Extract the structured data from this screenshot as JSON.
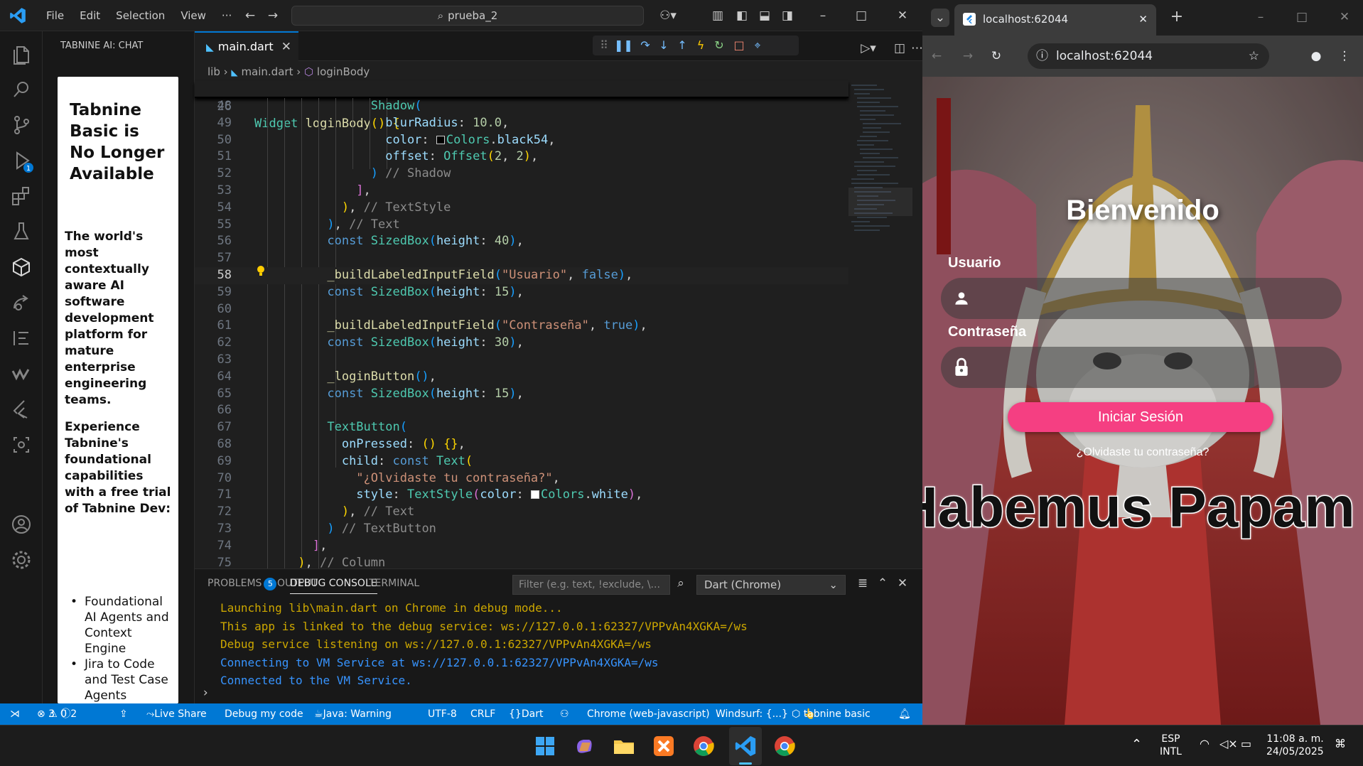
{
  "vscode": {
    "menu": [
      "File",
      "Edit",
      "Selection",
      "View",
      "···"
    ],
    "search": "prueba_2",
    "sidebar_title": "TABNINE AI: CHAT",
    "tabnine": {
      "heading": "Tabnine Basic is No Longer Available",
      "p1": "The world's most contextually aware AI software development platform for mature enterprise engineering teams.",
      "p2": "Experience Tabnine's foundational capabilities with a free trial of Tabnine Dev:",
      "list": [
        "Foundational AI Agents and Context Engine",
        "Jira to Code and Test Case Agents"
      ]
    },
    "tab": "main.dart",
    "breadcrumb": [
      "lib",
      "main.dart",
      "loginBody"
    ],
    "sticky": {
      "line": "26",
      "text": "Widget loginBody() {"
    },
    "current_line": "58",
    "code_lines": [
      {
        "n": "48",
        "html": "<span class='ty'>Shadow</span><span class='br3'>(</span>"
      },
      {
        "n": "49",
        "html": "  <span class='pr'>blurRadius</span>: <span class='nm'>10.0</span>,"
      },
      {
        "n": "50",
        "html": "  <span class='pr'>color</span>: <span class='swatch' style='background:#000'></span><span class='ty'>Colors</span>.<span class='pr'>black54</span>,"
      },
      {
        "n": "51",
        "html": "  <span class='pr'>offset</span>: <span class='ty'>Offset</span><span class='br1'>(</span><span class='nm'>2</span>, <span class='nm'>2</span><span class='br1'>)</span>,"
      },
      {
        "n": "52",
        "html": "<span class='br3'>)</span> <span class='gr'>// Shadow</span>"
      },
      {
        "n": "53",
        "html": "<span class='br2'>]</span>,"
      },
      {
        "n": "54",
        "html": "<span class='br1'>)</span>, <span class='gr'>// TextStyle</span>"
      },
      {
        "n": "55",
        "html": "<span class='br3'>)</span>, <span class='gr'>// Text</span>"
      },
      {
        "n": "56",
        "html": "<span class='kw'>const</span> <span class='ty'>SizedBox</span><span class='br3'>(</span><span class='pr'>height</span>: <span class='nm'>40</span><span class='br3'>)</span>,"
      },
      {
        "n": "57",
        "html": ""
      },
      {
        "n": "58",
        "html": "<span class='fn'>_buildLabeledInputField</span><span class='br3'>(</span><span class='st'>\"Usuario\"</span>, <span class='kw'>false</span><span class='br3'>)</span>,"
      },
      {
        "n": "59",
        "html": "<span class='kw'>const</span> <span class='ty'>SizedBox</span><span class='br3'>(</span><span class='pr'>height</span>: <span class='nm'>15</span><span class='br3'>)</span>,"
      },
      {
        "n": "60",
        "html": ""
      },
      {
        "n": "61",
        "html": "<span class='fn'>_buildLabeledInputField</span><span class='br3'>(</span><span class='st'>\"Contraseña\"</span>, <span class='kw'>true</span><span class='br3'>)</span>,"
      },
      {
        "n": "62",
        "html": "<span class='kw'>const</span> <span class='ty'>SizedBox</span><span class='br3'>(</span><span class='pr'>height</span>: <span class='nm'>30</span><span class='br3'>)</span>,"
      },
      {
        "n": "63",
        "html": ""
      },
      {
        "n": "64",
        "html": "<span class='fn'>_loginButton</span><span class='br3'>()</span>,"
      },
      {
        "n": "65",
        "html": "<span class='kw'>const</span> <span class='ty'>SizedBox</span><span class='br3'>(</span><span class='pr'>height</span>: <span class='nm'>15</span><span class='br3'>)</span>,"
      },
      {
        "n": "66",
        "html": ""
      },
      {
        "n": "67",
        "html": "<span class='ty'>TextButton</span><span class='br3'>(</span>"
      },
      {
        "n": "68",
        "html": "  <span class='pr'>onPressed</span>: <span class='br1'>()</span> <span class='br1'>{}</span>,"
      },
      {
        "n": "69",
        "html": "  <span class='pr'>child</span>: <span class='kw'>const</span> <span class='ty'>Text</span><span class='br1'>(</span>"
      },
      {
        "n": "70",
        "html": "    <span class='st'>\"¿Olvidaste tu contraseña?\"</span>,"
      },
      {
        "n": "71",
        "html": "    <span class='pr'>style</span>: <span class='ty'>TextStyle</span><span class='br2'>(</span><span class='pr'>color</span>: <span class='swatch' style='background:#fff'></span><span class='ty'>Colors</span>.<span class='pr'>white</span><span class='br2'>)</span>,"
      },
      {
        "n": "72",
        "html": "  <span class='br1'>)</span>, <span class='gr'>// Text</span>"
      },
      {
        "n": "73",
        "html": "<span class='br3'>)</span> <span class='gr'>// TextButton</span>"
      },
      {
        "n": "74",
        "html": "<span class='br2'>]</span>,"
      },
      {
        "n": "75",
        "html": "<span class='br1'>)</span>, <span class='gr'>// Column</span>"
      }
    ],
    "panel_tabs": [
      "PROBLEMS",
      "OUTPUT",
      "DEBUG CONSOLE",
      "TERMINAL"
    ],
    "problems_count": "5",
    "filter_placeholder": "Filter (e.g. text, !exclude, \\...",
    "debug_target": "Dart (Chrome)",
    "console": [
      {
        "cls": "c-y",
        "text": "Launching lib\\main.dart on Chrome in debug mode..."
      },
      {
        "cls": "c-y",
        "text": "This app is linked to the debug service: ws://127.0.0.1:62327/VPPvAn4XGKA=/ws"
      },
      {
        "cls": "c-y",
        "text": "Debug service listening on ws://127.0.0.1:62327/VPPvAn4XGKA=/ws"
      },
      {
        "cls": "c-b",
        "text": "Connecting to VM Service at ws://127.0.0.1:62327/VPPvAn4XGKA=/ws"
      },
      {
        "cls": "c-b",
        "text": "Connected to the VM Service."
      }
    ],
    "status": {
      "errors": "3",
      "warnings": "0",
      "infos": "2",
      "live_share": "Live Share",
      "debug": "Debug my code",
      "java": "Java: Warning",
      "encoding": "UTF-8",
      "eol": "CRLF",
      "lang": "Dart",
      "device": "Chrome (web-javascript)",
      "windsurf": "Windsurf: {...}",
      "tabnine": "tabnine basic"
    }
  },
  "chrome": {
    "tab_title": "localhost:62044",
    "url": "localhost:62044",
    "app": {
      "title": "Bienvenido",
      "user_label": "Usuario",
      "pass_label": "Contraseña",
      "login_button": "Iniciar Sesión",
      "forgot": "¿Olvidaste tu contraseña?",
      "meme_text": "Habemus Papam"
    }
  },
  "taskbar": {
    "lang1": "ESP",
    "lang2": "INTL",
    "time": "11:08 a. m.",
    "date": "24/05/2025"
  },
  "colors": {
    "accent": "#0078d4",
    "login_button": "#f53f82"
  }
}
